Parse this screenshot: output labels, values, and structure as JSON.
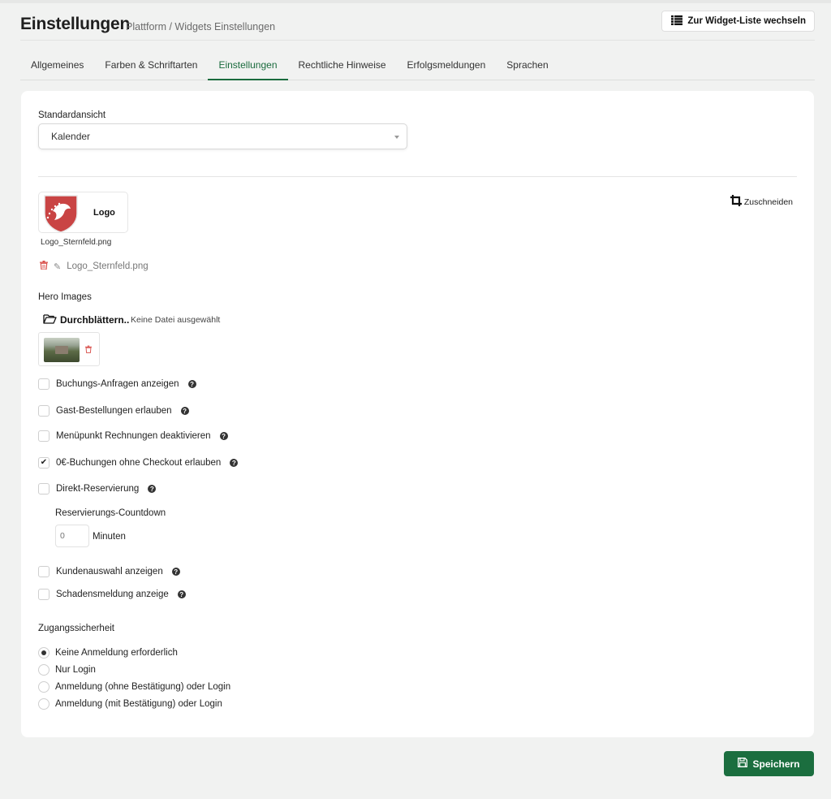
{
  "header": {
    "title": "Einstellungen",
    "subtitle": "Plattform / Widgets Einstellungen",
    "switch_button": "Zur Widget-Liste wechseln"
  },
  "tabs": [
    {
      "label": "Allgemeines",
      "active": false
    },
    {
      "label": "Farben & Schriftarten",
      "active": false
    },
    {
      "label": "Einstellungen",
      "active": true
    },
    {
      "label": "Rechtliche Hinweise",
      "active": false
    },
    {
      "label": "Erfolgsmeldungen",
      "active": false
    },
    {
      "label": "Sprachen",
      "active": false
    }
  ],
  "form": {
    "standardansicht_label": "Standardansicht",
    "standardansicht_value": "Kalender",
    "logo_text": "Logo",
    "logo_filename": "Logo_Sternfeld.png",
    "crop_label": "Zuschneiden",
    "logo_file_link": "Logo_Sternfeld.png",
    "hero_label": "Hero Images",
    "browse_label": "Durchblättern..",
    "no_file_label": "Keine Datei ausgewählt",
    "checkboxes": [
      {
        "label": "Buchungs-Anfragen anzeigen",
        "checked": false
      },
      {
        "label": "Gast-Bestellungen erlauben",
        "checked": false
      },
      {
        "label": "Menüpunkt Rechnungen deaktivieren",
        "checked": false
      },
      {
        "label": "0€-Buchungen ohne Checkout erlauben",
        "checked": true
      },
      {
        "label": "Direkt-Reservierung",
        "checked": false
      }
    ],
    "countdown_label": "Reservierungs-Countdown",
    "countdown_placeholder": "0",
    "countdown_unit": "Minuten",
    "checkboxes2": [
      {
        "label": "Kundenauswahl anzeigen",
        "checked": false
      },
      {
        "label": "Schadensmeldung anzeige",
        "checked": false
      }
    ],
    "access_label": "Zugangssicherheit",
    "radios": [
      {
        "label": "Keine Anmeldung erforderlich",
        "checked": true
      },
      {
        "label": "Nur Login",
        "checked": false
      },
      {
        "label": "Anmeldung (ohne Bestätigung) oder Login",
        "checked": false
      },
      {
        "label": "Anmeldung (mit Bestätigung) oder Login",
        "checked": false
      }
    ]
  },
  "save_button": "Speichern",
  "colors": {
    "accent": "#1b6e3f",
    "trash": "#d9534f",
    "shield": "#c94444"
  },
  "icons": {
    "list": "list-icon",
    "crop": "crop-icon",
    "trash": "trash-icon",
    "paperclip": "paperclip-icon",
    "folder": "folder-open-icon",
    "help": "question-circle-icon",
    "save": "floppy-disk-icon"
  }
}
